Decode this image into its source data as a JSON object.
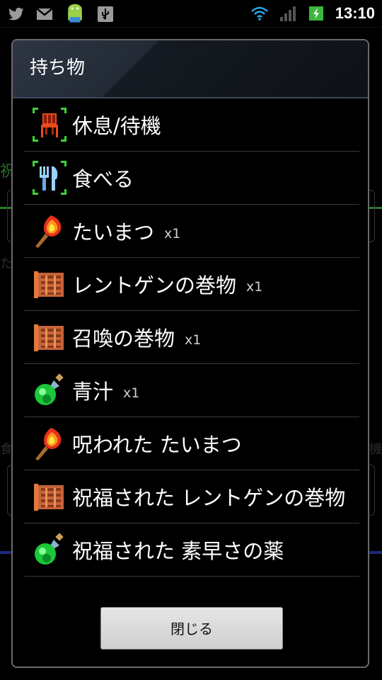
{
  "status_bar": {
    "time": "13:10",
    "icons_left": [
      "twitter-icon",
      "gmail-icon",
      "android-icon",
      "usb-icon"
    ],
    "icons_right": [
      "wifi-icon",
      "signal-icon",
      "battery-charging-icon"
    ]
  },
  "background": {
    "text_1": "祝",
    "text_2": "た",
    "text_3": "食",
    "text_4": "機"
  },
  "dialog": {
    "title": "持ち物",
    "items": [
      {
        "label": "休息/待機",
        "qty": "",
        "icon": "chair-icon"
      },
      {
        "label": "食べる",
        "qty": "",
        "icon": "fork-knife-icon"
      },
      {
        "label": "たいまつ",
        "qty": "x1",
        "icon": "torch-icon"
      },
      {
        "label": "レントゲンの巻物",
        "qty": "x1",
        "icon": "scroll-icon"
      },
      {
        "label": "召喚の巻物",
        "qty": "x1",
        "icon": "scroll-icon"
      },
      {
        "label": "青汁",
        "qty": "x1",
        "icon": "potion-icon"
      },
      {
        "label": "呪われた たいまつ",
        "qty": "",
        "icon": "torch-icon"
      },
      {
        "label": "祝福された レントゲンの巻物",
        "qty": "",
        "icon": "scroll-icon"
      },
      {
        "label": "祝福された 素早さの薬",
        "qty": "",
        "icon": "potion-icon"
      }
    ],
    "close_label": "閉じる"
  }
}
